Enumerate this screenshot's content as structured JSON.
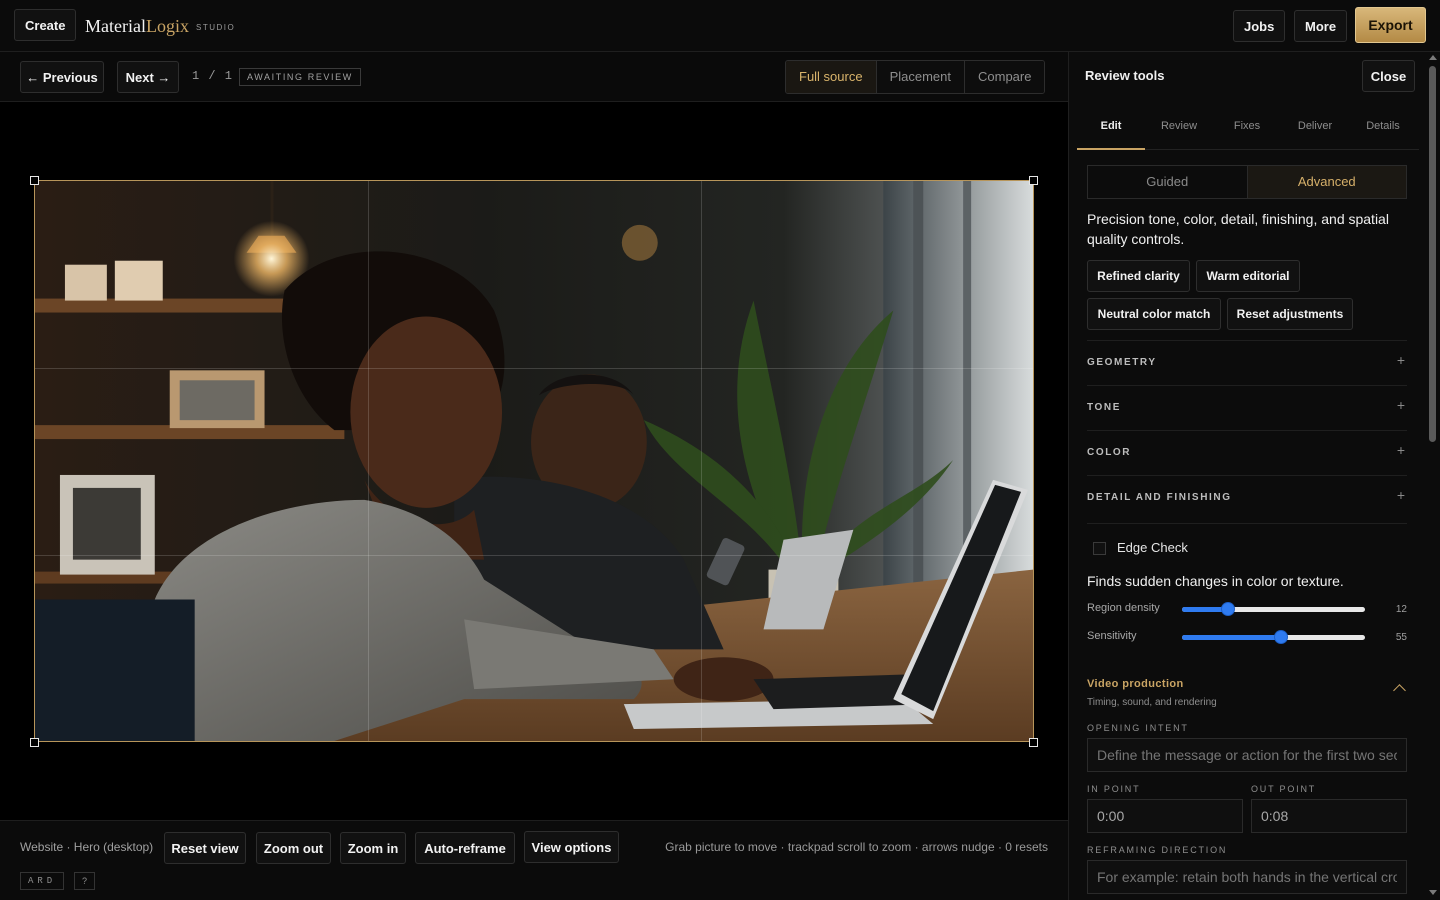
{
  "topbar": {
    "create_label": "Create",
    "brand_main": "Material",
    "brand_accent": "Logix",
    "brand_studio": "STUDIO",
    "jobs_label": "Jobs",
    "more_label": "More",
    "export_label": "Export"
  },
  "subbar": {
    "previous_label": "← Previous",
    "next_label": "Next →",
    "counter": "1 / 1",
    "status": "AWAITING REVIEW",
    "view_tabs": [
      {
        "label": "Full source",
        "active": true
      },
      {
        "label": "Placement",
        "active": false
      },
      {
        "label": "Compare",
        "active": false
      }
    ]
  },
  "canvas": {
    "image_description": "photo-of-woman-typing-on-laptop",
    "frame_color": "#b7955a"
  },
  "bottombar": {
    "placement_label": "Website · Hero (desktop)",
    "reset_view_label": "Reset view",
    "zoom_out_label": "Zoom out",
    "zoom_in_label": "Zoom in",
    "auto_reframe_label": "Auto-reframe",
    "view_options_label": "View options",
    "hint": "Grab picture to move · trackpad scroll to zoom · arrows nudge · 0 resets",
    "shortcut_keys": "ARD",
    "help_key": "?"
  },
  "panel": {
    "title": "Review tools",
    "close_label": "Close",
    "tabs": [
      {
        "label": "Edit",
        "active": true
      },
      {
        "label": "Review",
        "active": false
      },
      {
        "label": "Fixes",
        "active": false
      },
      {
        "label": "Deliver",
        "active": false
      },
      {
        "label": "Details",
        "active": false
      }
    ],
    "modes": [
      {
        "label": "Guided",
        "active": false
      },
      {
        "label": "Advanced",
        "active": true
      }
    ],
    "description": "Precision tone, color, detail, finishing, and spatial quality controls.",
    "presets": [
      "Refined clarity",
      "Warm editorial",
      "Neutral color match",
      "Reset adjustments"
    ],
    "sections": [
      "GEOMETRY",
      "TONE",
      "COLOR",
      "DETAIL AND FINISHING"
    ],
    "section_toggle": "+",
    "edge_check": {
      "label": "Edge Check",
      "checked": false,
      "description": "Finds sudden changes in color or texture.",
      "sliders": [
        {
          "label": "Region density",
          "value": "12",
          "fraction": 0.25
        },
        {
          "label": "Sensitivity",
          "value": "55",
          "fraction": 0.54
        }
      ]
    },
    "video": {
      "title": "Video production",
      "subtitle": "Timing, sound, and rendering",
      "opening_intent_label": "OPENING INTENT",
      "opening_intent_placeholder": "Define the message or action for the first two seconds",
      "in_point_label": "IN POINT",
      "in_point_value": "0:00",
      "out_point_label": "OUT POINT",
      "out_point_value": "0:08",
      "reframing_label": "REFRAMING DIRECTION",
      "reframing_placeholder": "For example: retain both hands in the vertical crop"
    }
  },
  "colors": {
    "accent": "#c9a464",
    "slider_blue": "#2f7bf0",
    "background": "#000000"
  }
}
